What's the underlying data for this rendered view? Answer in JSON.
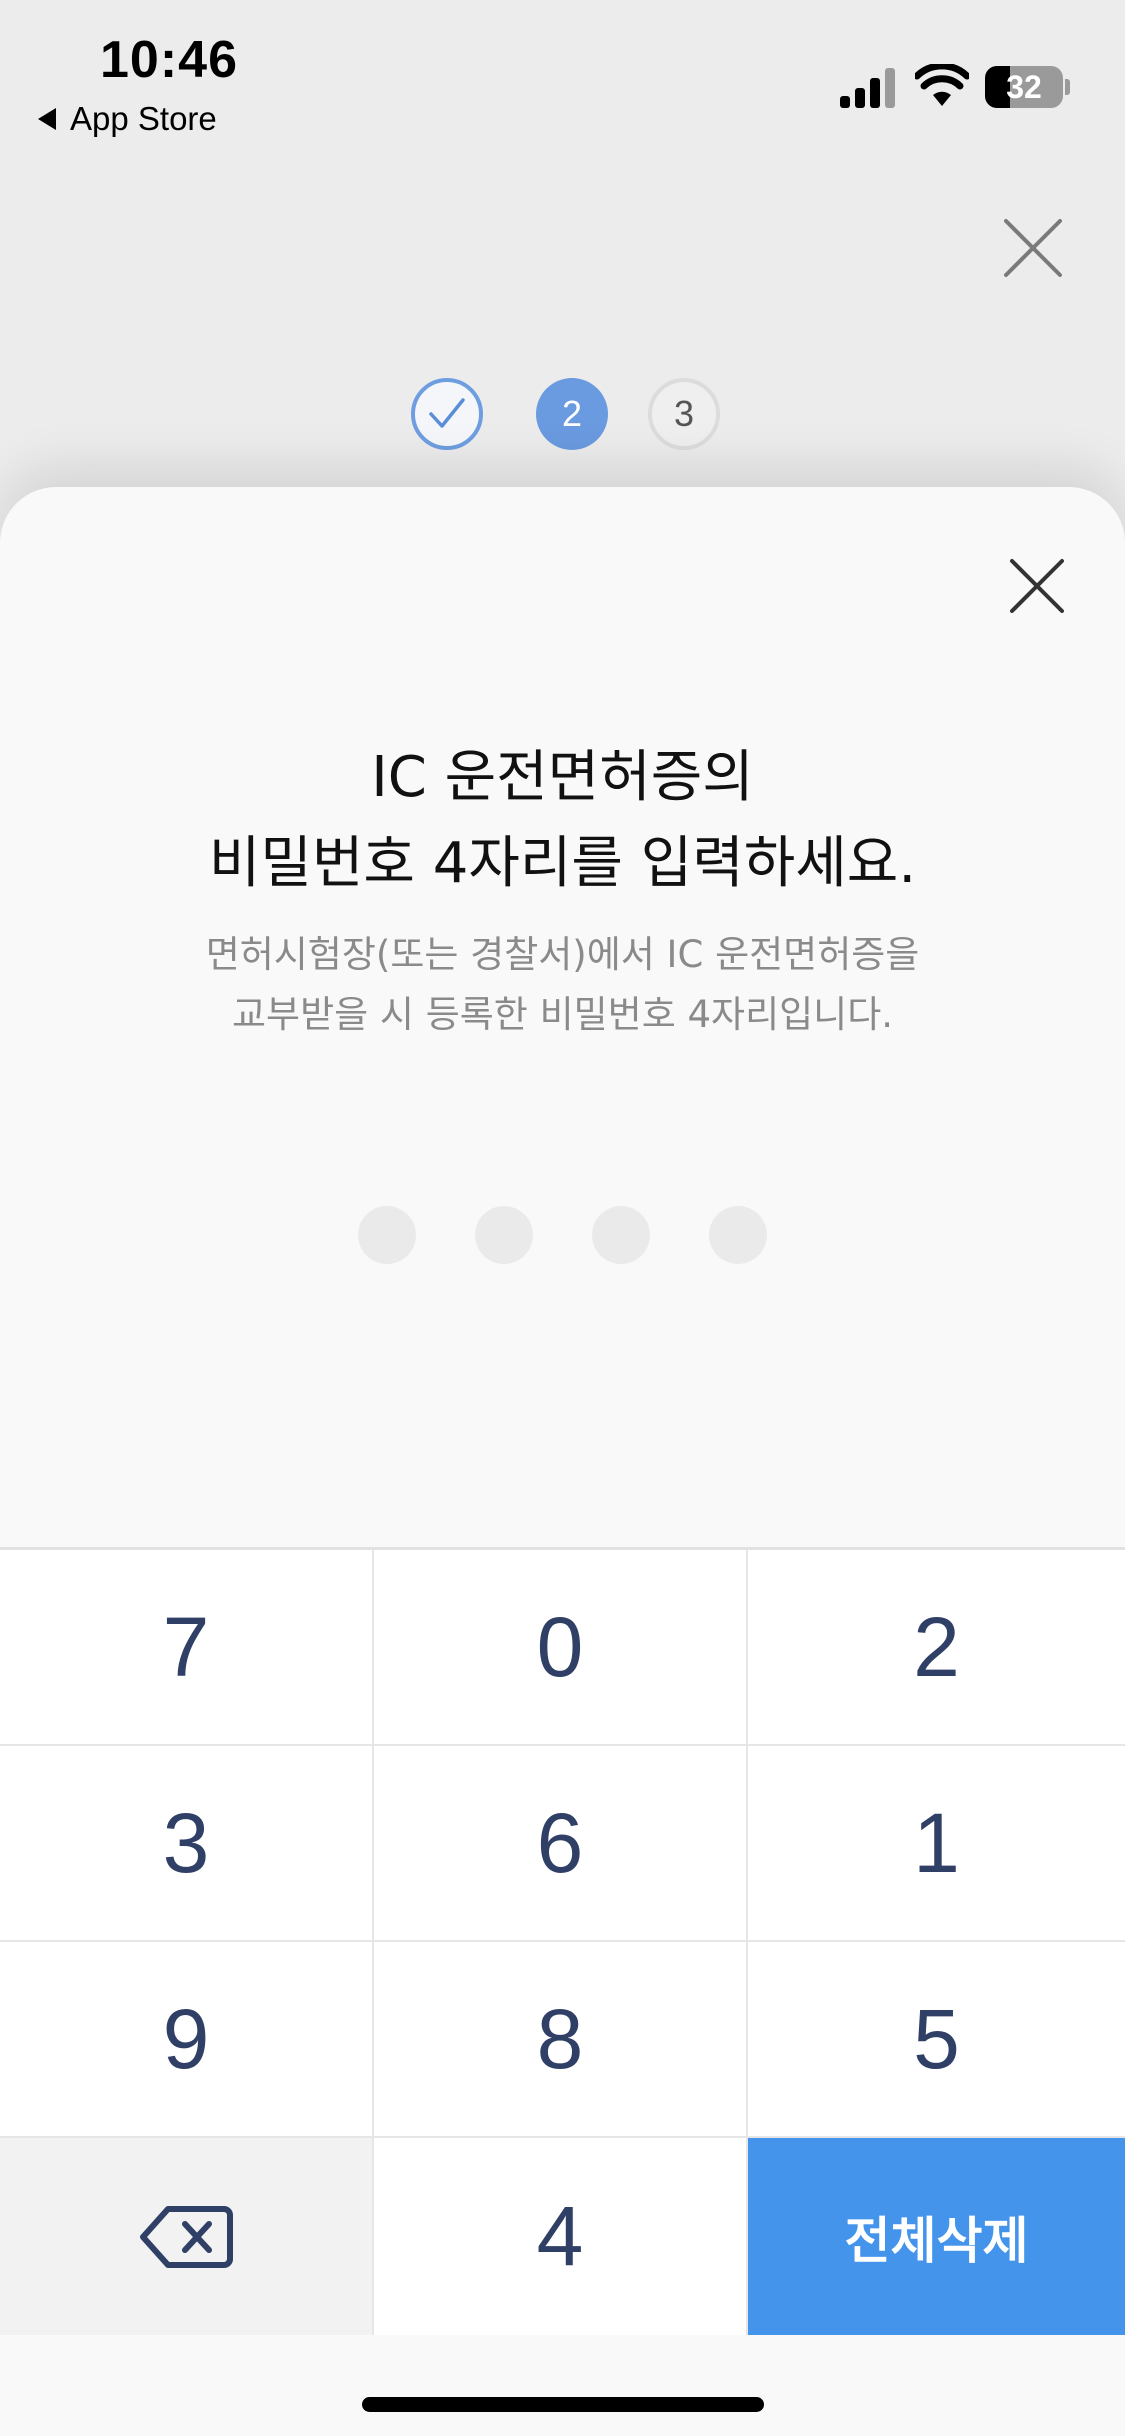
{
  "status_bar": {
    "time": "10:46",
    "back_app": "App Store",
    "battery": "32",
    "battery_level_percent": 32
  },
  "progress": {
    "current_step": 2,
    "steps": [
      {
        "state": "done",
        "label": ""
      },
      {
        "state": "current",
        "label": "2"
      },
      {
        "state": "upcoming",
        "label": "3"
      }
    ]
  },
  "dialog": {
    "title_lines": [
      "IC 운전면허증의",
      "비밀번호 4자리를 입력하세요."
    ],
    "subtitle_lines": [
      "면허시험장(또는 경찰서)에서 IC 운전면허증을",
      "교부받을 시 등록한 비밀번호 4자리입니다."
    ],
    "pin_length": 4,
    "pin_entered": 0
  },
  "keypad": {
    "rows": [
      [
        "7",
        "0",
        "2"
      ],
      [
        "3",
        "6",
        "1"
      ],
      [
        "9",
        "8",
        "5"
      ]
    ],
    "last_row_digit": "4",
    "clear_all_label": "전체삭제"
  },
  "icons": {
    "back": "back-triangle-icon",
    "signal": "cellular-signal-icon",
    "wifi": "wifi-icon",
    "close": "close-icon",
    "check": "check-icon",
    "backspace": "backspace-icon"
  },
  "colors": {
    "accent": "#4494ec",
    "step_current": "#6a9ae0",
    "key_text": "#2f3f66"
  }
}
